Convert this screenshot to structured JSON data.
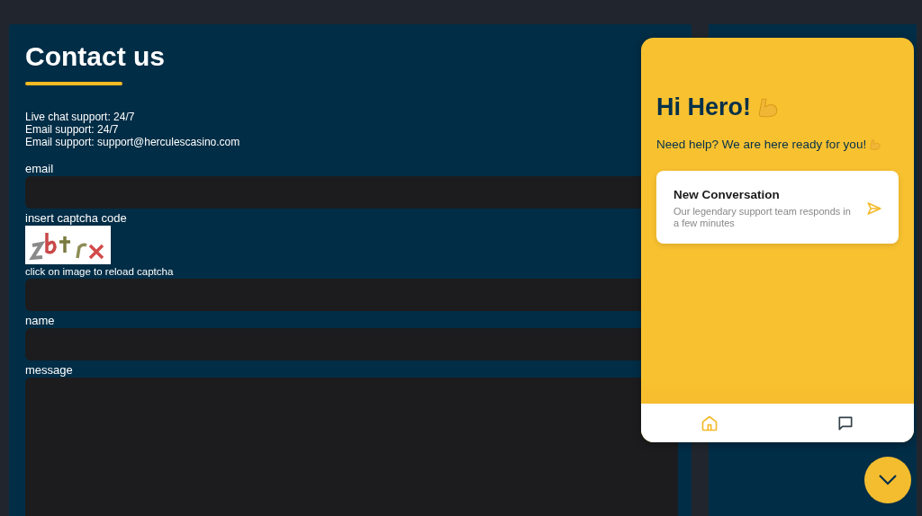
{
  "page": {
    "title": "Contact us",
    "info_lines": [
      "Live chat support: 24/7",
      "Email support: 24/7",
      "Email support: support@herculescasino.com"
    ]
  },
  "form": {
    "fields": [
      {
        "label": "email",
        "kind": "input"
      },
      {
        "label": "insert captcha code",
        "kind": "captcha",
        "hint": "click on image to reload captcha"
      },
      {
        "label": "name",
        "kind": "input"
      },
      {
        "label": "message",
        "kind": "textarea"
      }
    ]
  },
  "chat_widget": {
    "greeting": "Hi Hero!",
    "subtitle": "Need help? We are here ready for you!",
    "card": {
      "title": "New Conversation",
      "text": "Our legendary support team responds in a few minutes"
    },
    "nav": [
      {
        "kind": "home",
        "selected": true
      },
      {
        "kind": "messages",
        "selected": false
      }
    ]
  }
}
